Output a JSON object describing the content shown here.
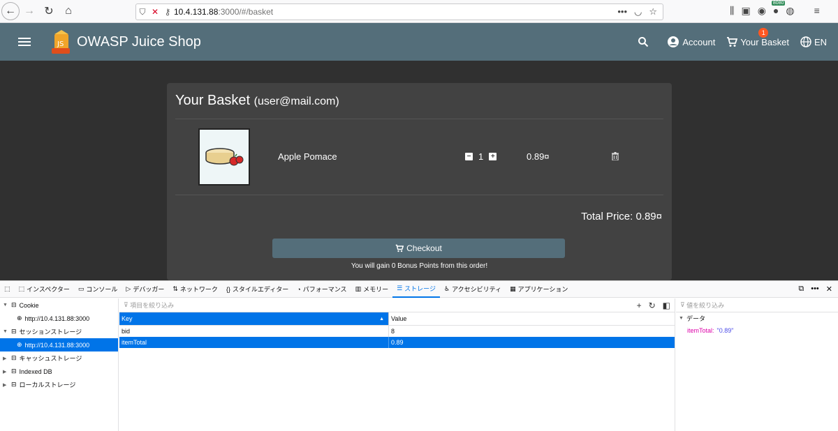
{
  "browser": {
    "url_host": "10.4.131.88",
    "url_rest": ":3000/#/basket",
    "ext_badge": "8080"
  },
  "toolbar": {
    "title": "OWASP Juice Shop",
    "account_label": "Account",
    "basket_label": "Your Basket",
    "basket_count": "1",
    "language": "EN"
  },
  "basket": {
    "title": "Your Basket",
    "user": "(user@mail.com)",
    "item_name": "Apple Pomace",
    "quantity": "1",
    "item_price": "0.89¤",
    "total_label": "Total Price: 0.89¤",
    "checkout_label": "Checkout",
    "bonus_text": "You will gain 0 Bonus Points from this order!"
  },
  "devtools": {
    "tabs": [
      "インスペクター",
      "コンソール",
      "デバッガー",
      "ネットワーク",
      "スタイルエディター",
      "パフォーマンス",
      "メモリー",
      "ストレージ",
      "アクセシビリティ",
      "アプリケーション"
    ],
    "tree": {
      "cookie": "Cookie",
      "cookie_host": "http://10.4.131.88:3000",
      "session": "セッションストレージ",
      "session_host": "http://10.4.131.88:3000",
      "cache": "キャッシュストレージ",
      "indexeddb": "Indexed DB",
      "local": "ローカルストレージ"
    },
    "filter_placeholder": "項目を絞り込み",
    "columns": {
      "key": "Key",
      "value": "Value"
    },
    "rows": [
      {
        "key": "bid",
        "value": "8"
      },
      {
        "key": "itemTotal",
        "value": "0.89"
      }
    ],
    "side_filter_placeholder": "値を絞り込み",
    "side_section": "データ",
    "side_prop_key": "itemTotal:",
    "side_prop_value": "\"0.89\""
  }
}
